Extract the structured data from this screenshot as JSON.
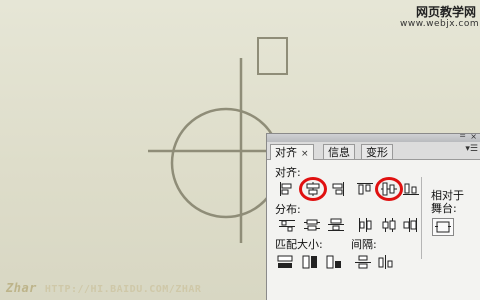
{
  "site": {
    "name_cn": "网页教学网",
    "name_en": "www.webjx.com"
  },
  "watermark": {
    "brand": "Zhar",
    "url": "HTTP://HI.BAIDU.COM/ZHAR"
  },
  "panel": {
    "tabs": [
      {
        "label": "对齐",
        "close": "×",
        "active": true
      },
      {
        "label": "信息",
        "active": false
      },
      {
        "label": "变形",
        "active": false
      }
    ],
    "sections": {
      "align": "对齐:",
      "distribute": "分布:",
      "match_size": "匹配大小:",
      "spacing": "间隔:",
      "relative": "相对于",
      "stage": "舞台:"
    },
    "highlight_color": "#e01010",
    "highlighted_buttons": [
      "align-horizontal-center",
      "align-vertical-center"
    ]
  },
  "canvas": {
    "stroke_color": "#8f8d78"
  }
}
